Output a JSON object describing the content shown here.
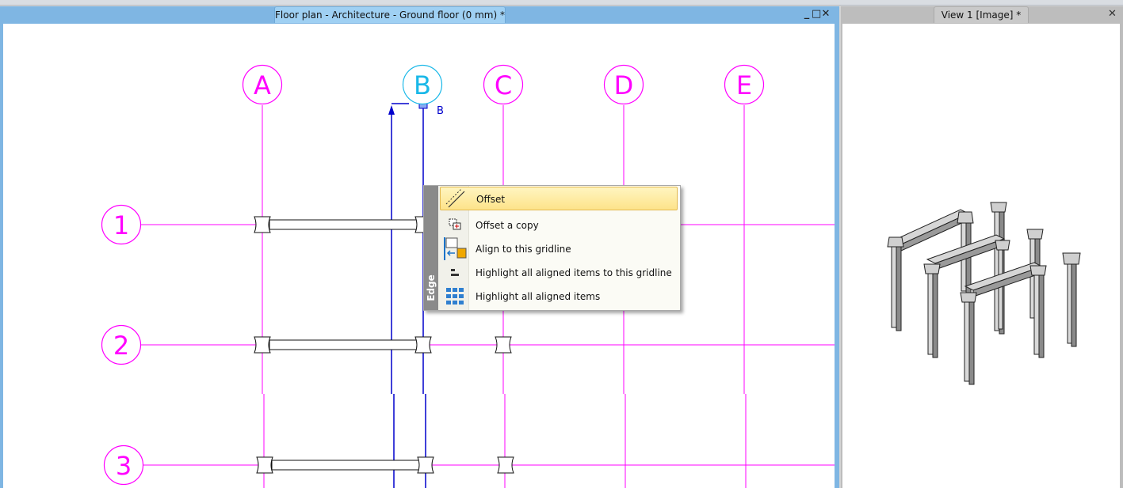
{
  "tabs": {
    "floor_plan": "Floor plan - Architecture - Ground floor (0 mm) *",
    "view": "View 1 [Image] *"
  },
  "window_controls": {
    "minimize": "_",
    "restore": "□",
    "close": "✕"
  },
  "grid": {
    "columns": [
      "A",
      "B",
      "C",
      "D",
      "E"
    ],
    "rows": [
      "1",
      "2",
      "3"
    ],
    "selected_label": "B",
    "grid_color": "#ff00ff",
    "selected_color": "#1ab8e8",
    "selection_line_color": "#0000cc"
  },
  "context_menu": {
    "side_label": "Edge",
    "items": [
      {
        "label": "Offset",
        "icon": "offset-line-icon"
      },
      {
        "label": "Offset a copy",
        "icon": "offset-copy-icon"
      },
      {
        "label": "Align to this gridline",
        "icon": "align-gridline-icon"
      },
      {
        "label": "Highlight all aligned items to this gridline",
        "icon": "highlight-aligned-gridline-icon"
      },
      {
        "label": "Highlight all aligned items",
        "icon": "highlight-all-icon"
      }
    ]
  }
}
